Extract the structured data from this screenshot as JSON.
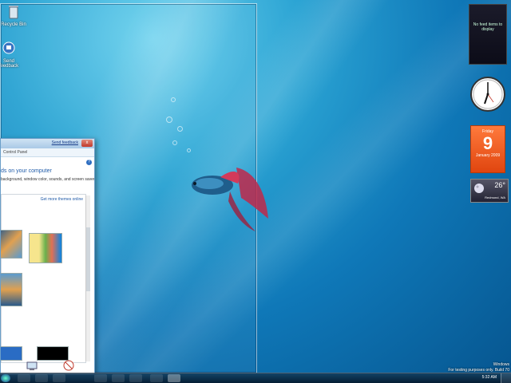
{
  "desktop": {
    "icons": [
      {
        "label": "Recycle Bin",
        "icon": "recycle-bin-icon"
      },
      {
        "label": "Send feedback",
        "icon": "feedback-icon"
      }
    ]
  },
  "control_panel": {
    "feedback_link": "Send feedback",
    "address": "Control Panel",
    "heading": "ds on your computer",
    "subtext": "background, window color, sounds, and screen saver",
    "more_themes": "Get more themes online",
    "close": "x"
  },
  "gadgets": {
    "feed": {
      "text": "No feed items to display"
    },
    "calendar": {
      "day": "Friday",
      "date": "9",
      "month_year": "January 2009"
    },
    "weather": {
      "temp": "26°",
      "location": "Redmond, WA"
    }
  },
  "watermark": {
    "line1": "Windows",
    "line2": "For testing purposes only. Build 70"
  },
  "taskbar": {
    "time": "5:32 AM"
  },
  "colors": {
    "accent": "#1e5aa8",
    "calendar": "#e0450f"
  }
}
